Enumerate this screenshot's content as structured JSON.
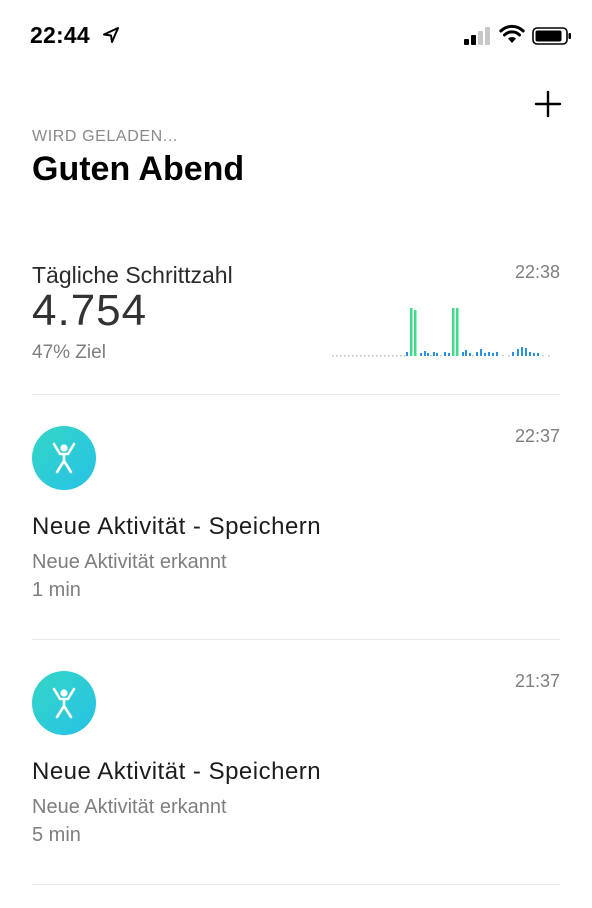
{
  "status_bar": {
    "time": "22:44",
    "location_icon": "location-arrow-icon",
    "signal_icon": "cellular-signal-icon",
    "wifi_icon": "wifi-icon",
    "battery_icon": "battery-icon"
  },
  "header": {
    "add_icon": "plus-icon",
    "loading_text": "WIRD GELADEN...",
    "greeting": "Guten Abend"
  },
  "steps_card": {
    "title": "Tägliche Schrittzahl",
    "time": "22:38",
    "value": "4.754",
    "goal": "47% Ziel"
  },
  "activities": [
    {
      "icon": "running-figure-icon",
      "time": "22:37",
      "title": "Neue Aktivität - Speichern",
      "subtitle": "Neue Aktivität erkannt",
      "duration": "1 min"
    },
    {
      "icon": "running-figure-icon",
      "time": "21:37",
      "title": "Neue Aktivität - Speichern",
      "subtitle": "Neue Aktivität erkannt",
      "duration": "5 min"
    }
  ],
  "colors": {
    "accent_green": "#3fdc8b",
    "accent_blue": "#2a90e6",
    "icon_gradient_start": "#34d6c6",
    "icon_gradient_end": "#27c1e6"
  }
}
